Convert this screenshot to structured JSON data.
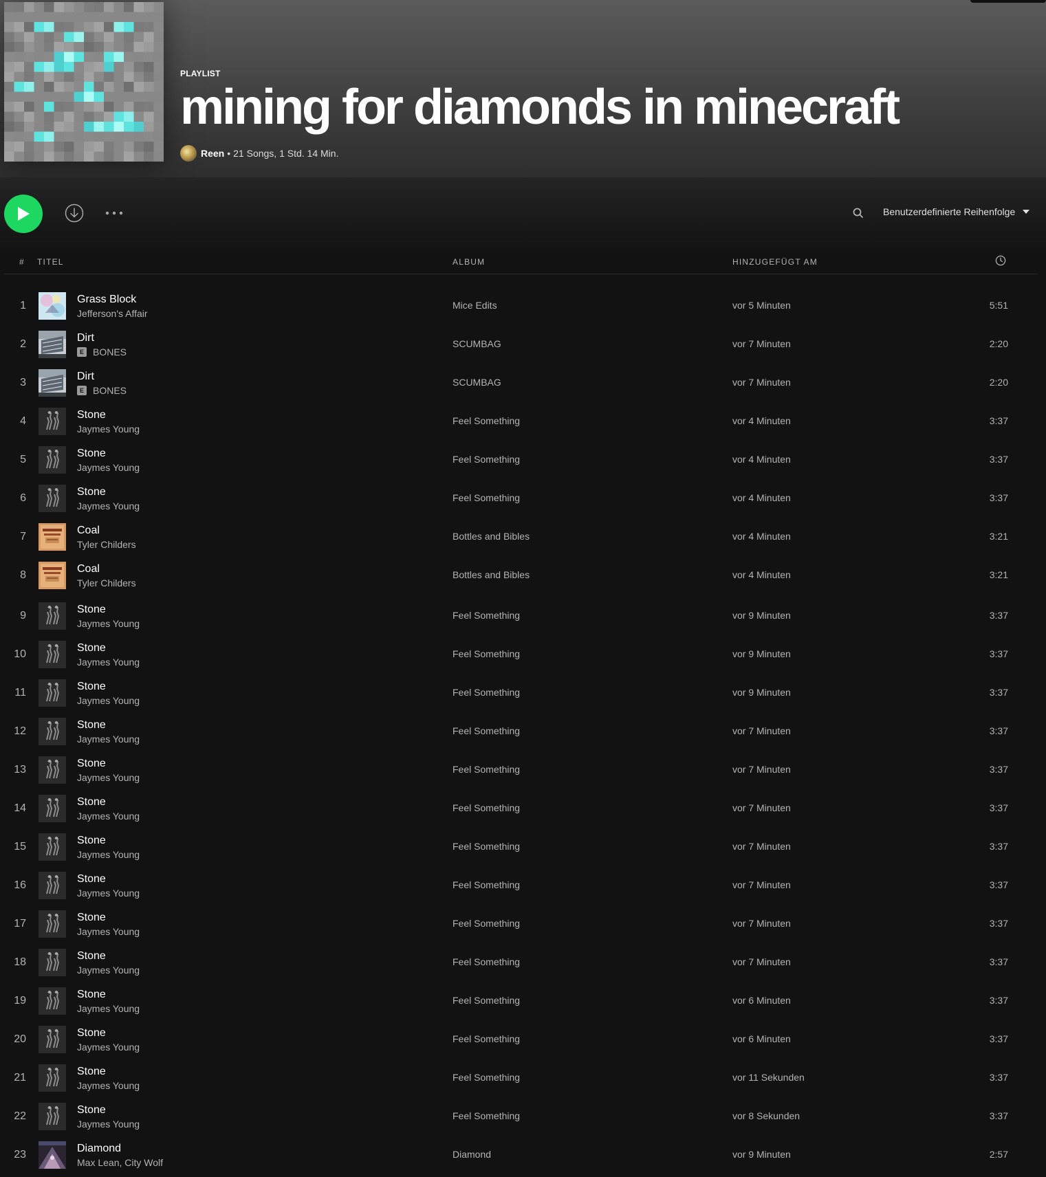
{
  "header": {
    "type_label": "PLAYLIST",
    "title": "mining for diamonds in minecraft",
    "owner": "Reen",
    "separator": "•",
    "summary": "21 Songs, 1 Std. 14 Min."
  },
  "toolbar": {
    "play_icon": "play-icon",
    "download_icon": "download-icon",
    "more_icon": "more-options-icon",
    "search_icon": "search-icon",
    "sort_label": "Benutzerdefinierte Reihenfolge",
    "sort_icon": "caret-down-icon"
  },
  "columns": {
    "number": "#",
    "title": "TITEL",
    "album": "ALBUM",
    "added": "HINZUGEFÜGT AM",
    "duration_icon": "clock-icon"
  },
  "colors": {
    "accent": "#1ed760",
    "background": "#121212",
    "muted_text": "#b3b3b3"
  },
  "tracks": [
    {
      "num": "1",
      "title": "Grass Block",
      "artist": "Jefferson's Affair",
      "explicit": false,
      "album": "Mice Edits",
      "added": "vor 5 Minuten",
      "duration": "5:51",
      "art": "grass"
    },
    {
      "num": "2",
      "title": "Dirt",
      "artist": "BONES",
      "explicit": true,
      "album": "SCUMBAG",
      "added": "vor 7 Minuten",
      "duration": "2:20",
      "art": "dirt"
    },
    {
      "num": "3",
      "title": "Dirt",
      "artist": "BONES",
      "explicit": true,
      "album": "SCUMBAG",
      "added": "vor 7 Minuten",
      "duration": "2:20",
      "art": "dirt"
    },
    {
      "num": "4",
      "title": "Stone",
      "artist": "Jaymes Young",
      "explicit": false,
      "album": "Feel Something",
      "added": "vor 4 Minuten",
      "duration": "3:37",
      "art": "stone"
    },
    {
      "num": "5",
      "title": "Stone",
      "artist": "Jaymes Young",
      "explicit": false,
      "album": "Feel Something",
      "added": "vor 4 Minuten",
      "duration": "3:37",
      "art": "stone"
    },
    {
      "num": "6",
      "title": "Stone",
      "artist": "Jaymes Young",
      "explicit": false,
      "album": "Feel Something",
      "added": "vor 4 Minuten",
      "duration": "3:37",
      "art": "stone"
    },
    {
      "num": "7",
      "title": "Coal",
      "artist": "Tyler Childers",
      "explicit": false,
      "album": "Bottles and Bibles",
      "added": "vor 4 Minuten",
      "duration": "3:21",
      "art": "coal"
    },
    {
      "num": "8",
      "title": "Coal",
      "artist": "Tyler Childers",
      "explicit": false,
      "album": "Bottles and Bibles",
      "added": "vor 4 Minuten",
      "duration": "3:21",
      "art": "coal"
    },
    {
      "num": "9",
      "title": "Stone",
      "artist": "Jaymes Young",
      "explicit": false,
      "album": "Feel Something",
      "added": "vor 9 Minuten",
      "duration": "3:37",
      "art": "stone"
    },
    {
      "num": "10",
      "title": "Stone",
      "artist": "Jaymes Young",
      "explicit": false,
      "album": "Feel Something",
      "added": "vor 9 Minuten",
      "duration": "3:37",
      "art": "stone"
    },
    {
      "num": "11",
      "title": "Stone",
      "artist": "Jaymes Young",
      "explicit": false,
      "album": "Feel Something",
      "added": "vor 9 Minuten",
      "duration": "3:37",
      "art": "stone"
    },
    {
      "num": "12",
      "title": "Stone",
      "artist": "Jaymes Young",
      "explicit": false,
      "album": "Feel Something",
      "added": "vor 7 Minuten",
      "duration": "3:37",
      "art": "stone"
    },
    {
      "num": "13",
      "title": "Stone",
      "artist": "Jaymes Young",
      "explicit": false,
      "album": "Feel Something",
      "added": "vor 7 Minuten",
      "duration": "3:37",
      "art": "stone"
    },
    {
      "num": "14",
      "title": "Stone",
      "artist": "Jaymes Young",
      "explicit": false,
      "album": "Feel Something",
      "added": "vor 7 Minuten",
      "duration": "3:37",
      "art": "stone"
    },
    {
      "num": "15",
      "title": "Stone",
      "artist": "Jaymes Young",
      "explicit": false,
      "album": "Feel Something",
      "added": "vor 7 Minuten",
      "duration": "3:37",
      "art": "stone"
    },
    {
      "num": "16",
      "title": "Stone",
      "artist": "Jaymes Young",
      "explicit": false,
      "album": "Feel Something",
      "added": "vor 7 Minuten",
      "duration": "3:37",
      "art": "stone"
    },
    {
      "num": "17",
      "title": "Stone",
      "artist": "Jaymes Young",
      "explicit": false,
      "album": "Feel Something",
      "added": "vor 7 Minuten",
      "duration": "3:37",
      "art": "stone"
    },
    {
      "num": "18",
      "title": "Stone",
      "artist": "Jaymes Young",
      "explicit": false,
      "album": "Feel Something",
      "added": "vor 7 Minuten",
      "duration": "3:37",
      "art": "stone"
    },
    {
      "num": "19",
      "title": "Stone",
      "artist": "Jaymes Young",
      "explicit": false,
      "album": "Feel Something",
      "added": "vor 6 Minuten",
      "duration": "3:37",
      "art": "stone"
    },
    {
      "num": "20",
      "title": "Stone",
      "artist": "Jaymes Young",
      "explicit": false,
      "album": "Feel Something",
      "added": "vor 6 Minuten",
      "duration": "3:37",
      "art": "stone"
    },
    {
      "num": "21",
      "title": "Stone",
      "artist": "Jaymes Young",
      "explicit": false,
      "album": "Feel Something",
      "added": "vor 11 Sekunden",
      "duration": "3:37",
      "art": "stone"
    },
    {
      "num": "22",
      "title": "Stone",
      "artist": "Jaymes Young",
      "explicit": false,
      "album": "Feel Something",
      "added": "vor 8 Sekunden",
      "duration": "3:37",
      "art": "stone"
    },
    {
      "num": "23",
      "title": "Diamond",
      "artist": "Max Lean, City Wolf",
      "explicit": false,
      "album": "Diamond",
      "added": "vor 9 Minuten",
      "duration": "2:57",
      "art": "diamond"
    }
  ]
}
